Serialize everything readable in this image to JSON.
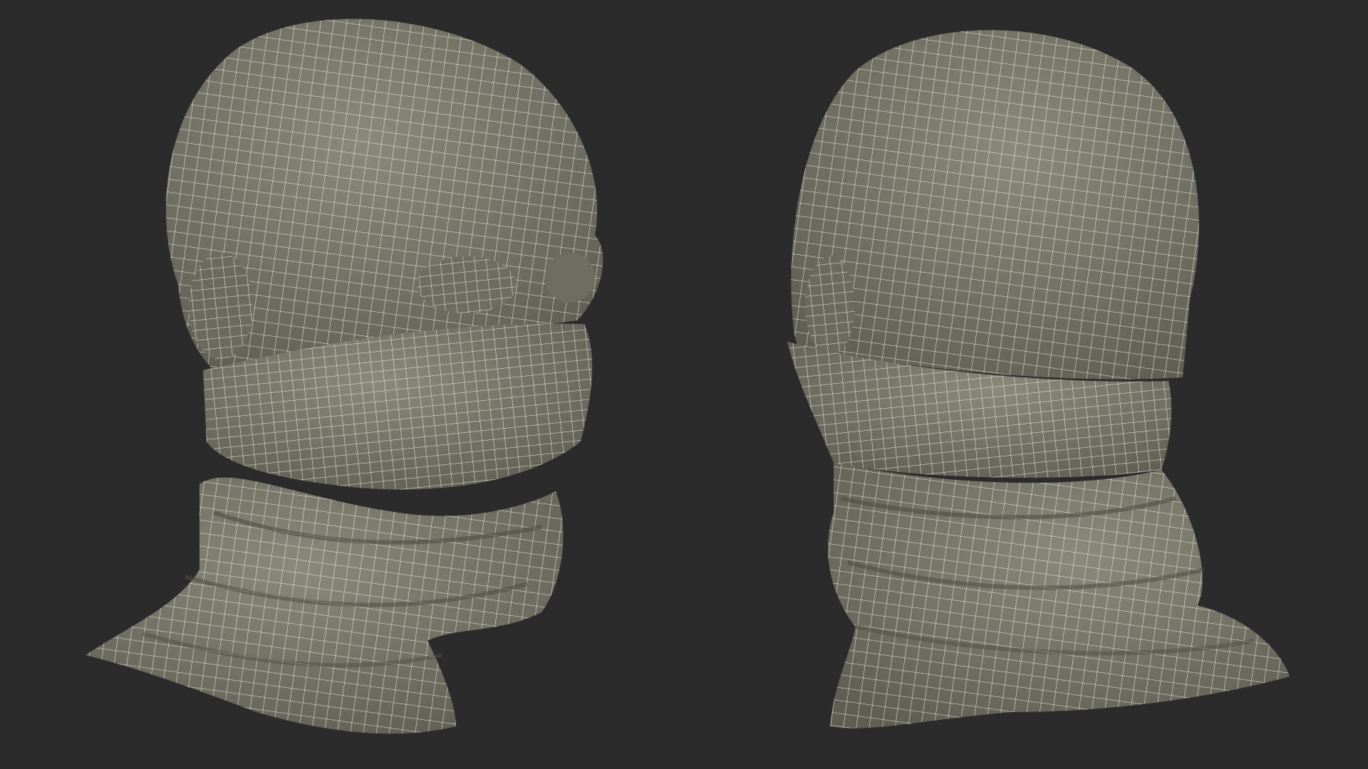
{
  "scene": {
    "background_color": "#2b2b2b",
    "mesh_fill_color": "#7d7c6e",
    "mesh_shade_color": "#5f5e53",
    "wire_color": "#f2f1e6",
    "views": [
      {
        "name": "head-with-neck-gaiter-front-three-quarter"
      },
      {
        "name": "head-with-neck-gaiter-back-three-quarter"
      }
    ]
  }
}
